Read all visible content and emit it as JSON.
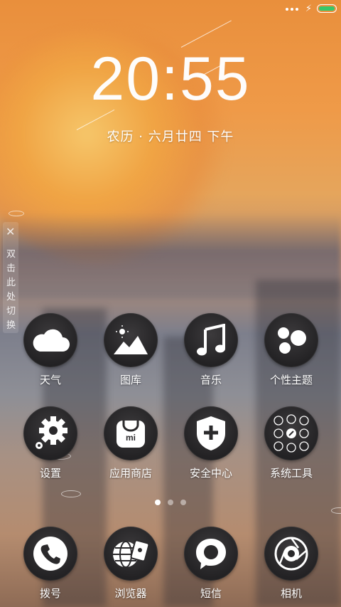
{
  "status_bar": {
    "battery_color": "#37c86a"
  },
  "lock": {
    "time_hours": "20",
    "time_colon": ":",
    "time_minutes": "55",
    "date": "农历 · 六月廿四  下午"
  },
  "side_hint": {
    "close": "✕",
    "text": "双击此处切换"
  },
  "apps_row1": [
    {
      "label": "天气",
      "icon": "weather-cloud-icon"
    },
    {
      "label": "图库",
      "icon": "gallery-icon"
    },
    {
      "label": "音乐",
      "icon": "music-note-icon"
    },
    {
      "label": "个性主题",
      "icon": "themes-icon"
    }
  ],
  "apps_row2": [
    {
      "label": "设置",
      "icon": "gear-icon"
    },
    {
      "label": "应用商店",
      "icon": "app-store-icon"
    },
    {
      "label": "安全中心",
      "icon": "shield-plus-icon"
    },
    {
      "label": "系统工具",
      "icon": "system-tools-icon"
    }
  ],
  "dock": [
    {
      "label": "拨号",
      "icon": "phone-icon"
    },
    {
      "label": "浏览器",
      "icon": "browser-globe-icon"
    },
    {
      "label": "短信",
      "icon": "message-bubble-icon"
    },
    {
      "label": "相机",
      "icon": "camera-lens-icon"
    }
  ],
  "pager": {
    "pages": 3,
    "current": 1
  }
}
